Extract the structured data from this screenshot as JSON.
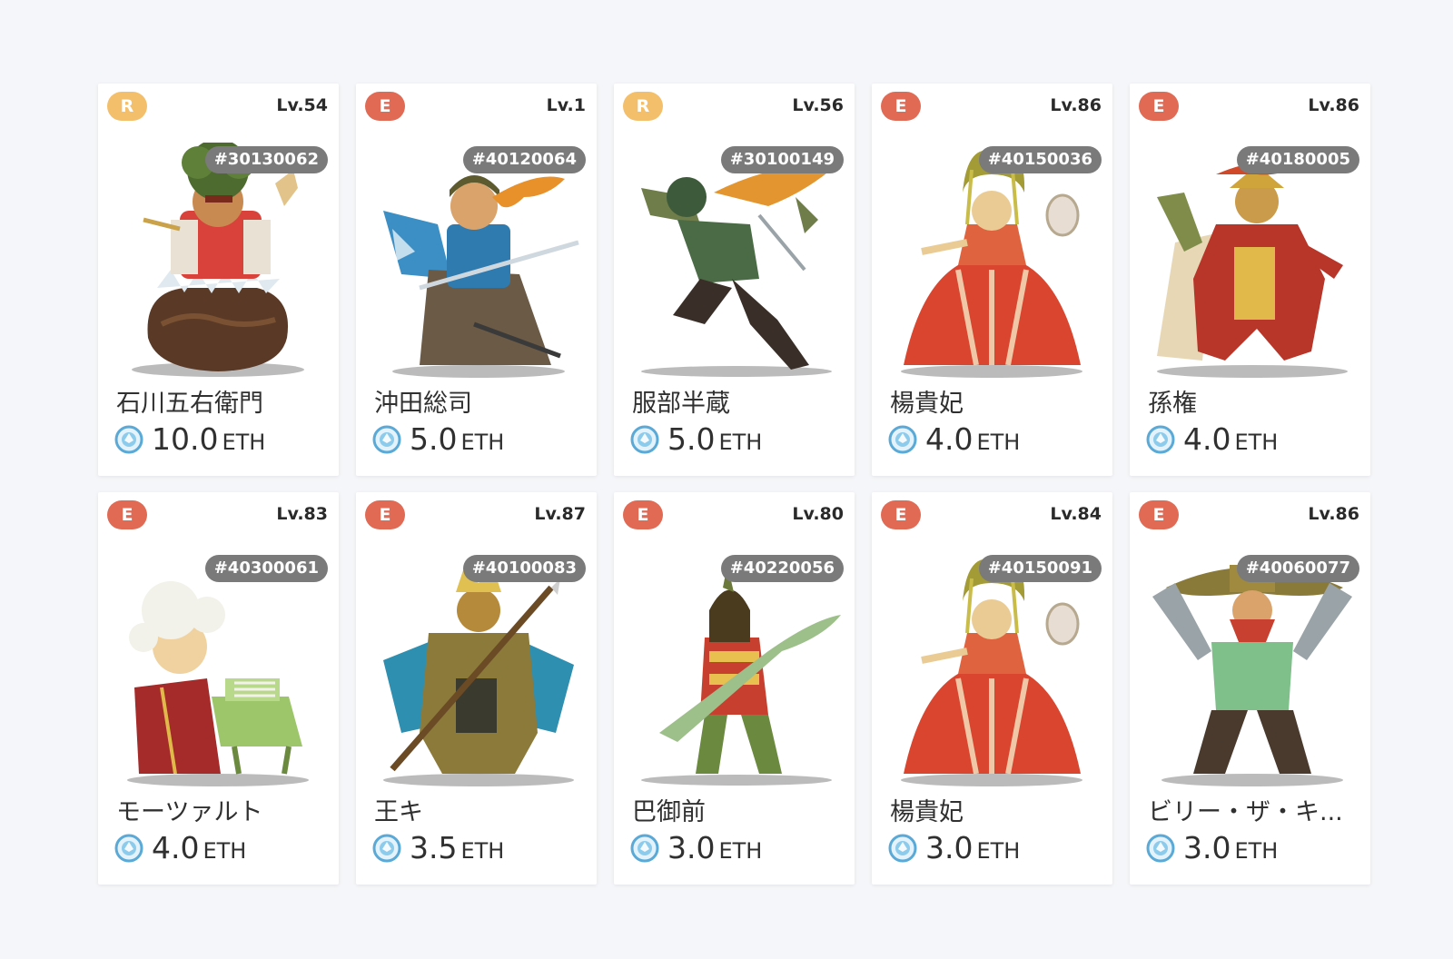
{
  "colors": {
    "rarity_R": "#f4bf6b",
    "rarity_E": "#e16a55",
    "eth_icon": "#5aa9d6"
  },
  "heroes": [
    {
      "rarity": "R",
      "level": "Lv.54",
      "token_id": "#30130062",
      "name": "石川五右衛門",
      "price": "10.0",
      "unit": "ETH",
      "art": "ishikawa-goemon"
    },
    {
      "rarity": "E",
      "level": "Lv.1",
      "token_id": "#40120064",
      "name": "沖田総司",
      "price": "5.0",
      "unit": "ETH",
      "art": "okita-soji"
    },
    {
      "rarity": "R",
      "level": "Lv.56",
      "token_id": "#30100149",
      "name": "服部半蔵",
      "price": "5.0",
      "unit": "ETH",
      "art": "hattori-hanzo"
    },
    {
      "rarity": "E",
      "level": "Lv.86",
      "token_id": "#40150036",
      "name": "楊貴妃",
      "price": "4.0",
      "unit": "ETH",
      "art": "yang-guifei"
    },
    {
      "rarity": "E",
      "level": "Lv.86",
      "token_id": "#40180005",
      "name": "孫権",
      "price": "4.0",
      "unit": "ETH",
      "art": "sun-quan"
    },
    {
      "rarity": "E",
      "level": "Lv.83",
      "token_id": "#40300061",
      "name": "モーツァルト",
      "price": "4.0",
      "unit": "ETH",
      "art": "mozart"
    },
    {
      "rarity": "E",
      "level": "Lv.87",
      "token_id": "#40100083",
      "name": "王キ",
      "price": "3.5",
      "unit": "ETH",
      "art": "ou-ki"
    },
    {
      "rarity": "E",
      "level": "Lv.80",
      "token_id": "#40220056",
      "name": "巴御前",
      "price": "3.0",
      "unit": "ETH",
      "art": "tomoe-gozen"
    },
    {
      "rarity": "E",
      "level": "Lv.84",
      "token_id": "#40150091",
      "name": "楊貴妃",
      "price": "3.0",
      "unit": "ETH",
      "art": "yang-guifei"
    },
    {
      "rarity": "E",
      "level": "Lv.86",
      "token_id": "#40060077",
      "name": "ビリー・ザ・キ...",
      "price": "3.0",
      "unit": "ETH",
      "art": "billy-the-kid"
    }
  ]
}
